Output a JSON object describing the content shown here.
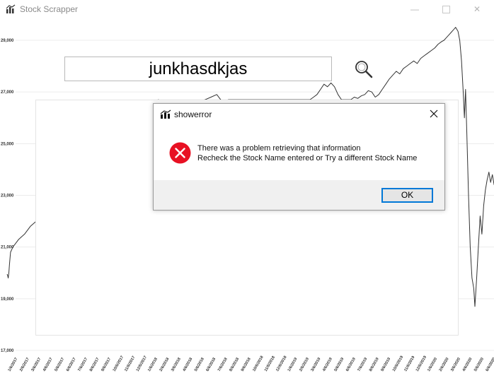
{
  "window": {
    "title": "Stock Scrapper",
    "controls": {
      "minimize": "—",
      "close": "✕"
    }
  },
  "search": {
    "value": "junkhasdkjas",
    "icon": "magnifier-icon"
  },
  "dialog": {
    "title": "showerror",
    "message_line1": "There was a problem retrieving that information",
    "message_line2": "Recheck the Stock Name entered or Try a different Stock Name",
    "ok_label": "OK",
    "close_label": "✕",
    "icon": "error-icon",
    "accent_color": "#0078d7",
    "error_color": "#e81123"
  },
  "chart_data": {
    "type": "line",
    "ylim": [
      17000,
      30000
    ],
    "y_ticks": [
      17000,
      19000,
      21000,
      23000,
      25000,
      27000,
      29000
    ],
    "y_tick_labels": [
      "17,000",
      "19,000",
      "21,000",
      "23,000",
      "25,000",
      "27,000",
      "29,000"
    ],
    "x_tick_labels": [
      "1/6/2017",
      "2/6/2017",
      "3/6/2017",
      "4/6/2017",
      "5/6/2017",
      "6/6/2017",
      "7/6/2017",
      "8/6/2017",
      "9/6/2017",
      "10/6/2017",
      "11/6/2017",
      "12/6/2017",
      "1/6/2018",
      "2/6/2018",
      "3/6/2018",
      "4/6/2018",
      "5/6/2018",
      "6/6/2018",
      "7/6/2018",
      "8/6/2018",
      "9/6/2018",
      "10/6/2018",
      "11/6/2018",
      "12/6/2018",
      "1/6/2019",
      "2/6/2019",
      "3/6/2019",
      "4/6/2019",
      "5/6/2019",
      "6/6/2019",
      "7/6/2019",
      "8/6/2019",
      "9/6/2019",
      "10/6/2019",
      "11/6/2019",
      "12/6/2019",
      "1/6/2020",
      "2/6/2020",
      "3/6/2020",
      "4/6/2020",
      "5/6/2020",
      "6/6/2020"
    ],
    "grid": true,
    "series": [
      {
        "color": "#333333",
        "points": [
          [
            0,
            19950
          ],
          [
            0.05,
            19900
          ],
          [
            0.1,
            19800
          ],
          [
            0.15,
            20000
          ],
          [
            0.2,
            20300
          ],
          [
            0.25,
            20550
          ],
          [
            0.3,
            20800
          ],
          [
            0.5,
            21000
          ],
          [
            1.0,
            21300
          ],
          [
            1.5,
            21500
          ],
          [
            2.0,
            21800
          ],
          [
            2.5,
            22000
          ],
          [
            3.0,
            22300
          ],
          [
            3.5,
            22500
          ],
          [
            4.0,
            22700
          ],
          [
            4.5,
            22900
          ],
          [
            5.0,
            23100
          ],
          [
            5.5,
            23300
          ],
          [
            6.0,
            23500
          ],
          [
            6.5,
            23700
          ],
          [
            7.0,
            23900
          ],
          [
            7.5,
            24200
          ],
          [
            8.0,
            24400
          ],
          [
            8.5,
            24600
          ],
          [
            9.0,
            24800
          ],
          [
            9.5,
            25000
          ],
          [
            10.0,
            25300
          ],
          [
            10.5,
            25600
          ],
          [
            11.0,
            25800
          ],
          [
            11.5,
            26100
          ],
          [
            12.0,
            26400
          ],
          [
            12.5,
            26600
          ],
          [
            13.0,
            26700
          ],
          [
            13.5,
            26500
          ],
          [
            14.0,
            26550
          ],
          [
            14.5,
            26600
          ],
          [
            15.0,
            26650
          ],
          [
            15.5,
            26550
          ],
          [
            16.0,
            26600
          ],
          [
            16.5,
            26650
          ],
          [
            17.0,
            26700
          ],
          [
            17.5,
            26800
          ],
          [
            18.0,
            26900
          ],
          [
            18.5,
            26600
          ],
          [
            19.0,
            26700
          ],
          [
            26.0,
            26700
          ],
          [
            26.3,
            26800
          ],
          [
            26.6,
            26900
          ],
          [
            26.9,
            27100
          ],
          [
            27.2,
            27300
          ],
          [
            27.5,
            27200
          ],
          [
            27.8,
            27350
          ],
          [
            28.1,
            27200
          ],
          [
            28.4,
            26900
          ],
          [
            28.7,
            26700
          ],
          [
            29.5,
            26700
          ],
          [
            29.8,
            26800
          ],
          [
            30.1,
            26750
          ],
          [
            30.4,
            26850
          ],
          [
            30.7,
            26900
          ],
          [
            31.0,
            27050
          ],
          [
            31.3,
            27000
          ],
          [
            31.6,
            26800
          ],
          [
            31.9,
            26900
          ],
          [
            32.2,
            27100
          ],
          [
            32.5,
            27300
          ],
          [
            32.8,
            27500
          ],
          [
            33.1,
            27650
          ],
          [
            33.4,
            27800
          ],
          [
            33.7,
            27700
          ],
          [
            34.0,
            27900
          ],
          [
            34.3,
            28000
          ],
          [
            34.6,
            28100
          ],
          [
            34.9,
            28200
          ],
          [
            35.2,
            28100
          ],
          [
            35.5,
            28300
          ],
          [
            35.8,
            28400
          ],
          [
            36.1,
            28500
          ],
          [
            36.4,
            28600
          ],
          [
            36.7,
            28700
          ],
          [
            37.0,
            28850
          ],
          [
            37.3,
            28950
          ],
          [
            37.5,
            29000
          ],
          [
            37.7,
            29100
          ],
          [
            37.9,
            29200
          ],
          [
            38.1,
            29300
          ],
          [
            38.3,
            29400
          ],
          [
            38.5,
            29500
          ],
          [
            38.7,
            29350
          ],
          [
            38.85,
            29000
          ],
          [
            39.0,
            28200
          ],
          [
            39.15,
            27000
          ],
          [
            39.25,
            26000
          ],
          [
            39.35,
            27100
          ],
          [
            39.45,
            25500
          ],
          [
            39.6,
            23000
          ],
          [
            39.75,
            21000
          ],
          [
            39.9,
            19800
          ],
          [
            40.05,
            19400
          ],
          [
            40.15,
            18700
          ],
          [
            40.3,
            19800
          ],
          [
            40.45,
            21000
          ],
          [
            40.6,
            22200
          ],
          [
            40.75,
            21500
          ],
          [
            40.9,
            22600
          ],
          [
            41.05,
            23200
          ],
          [
            41.2,
            23600
          ],
          [
            41.35,
            23900
          ],
          [
            41.5,
            23500
          ],
          [
            41.65,
            23800
          ],
          [
            41.8,
            23400
          ]
        ]
      }
    ]
  }
}
